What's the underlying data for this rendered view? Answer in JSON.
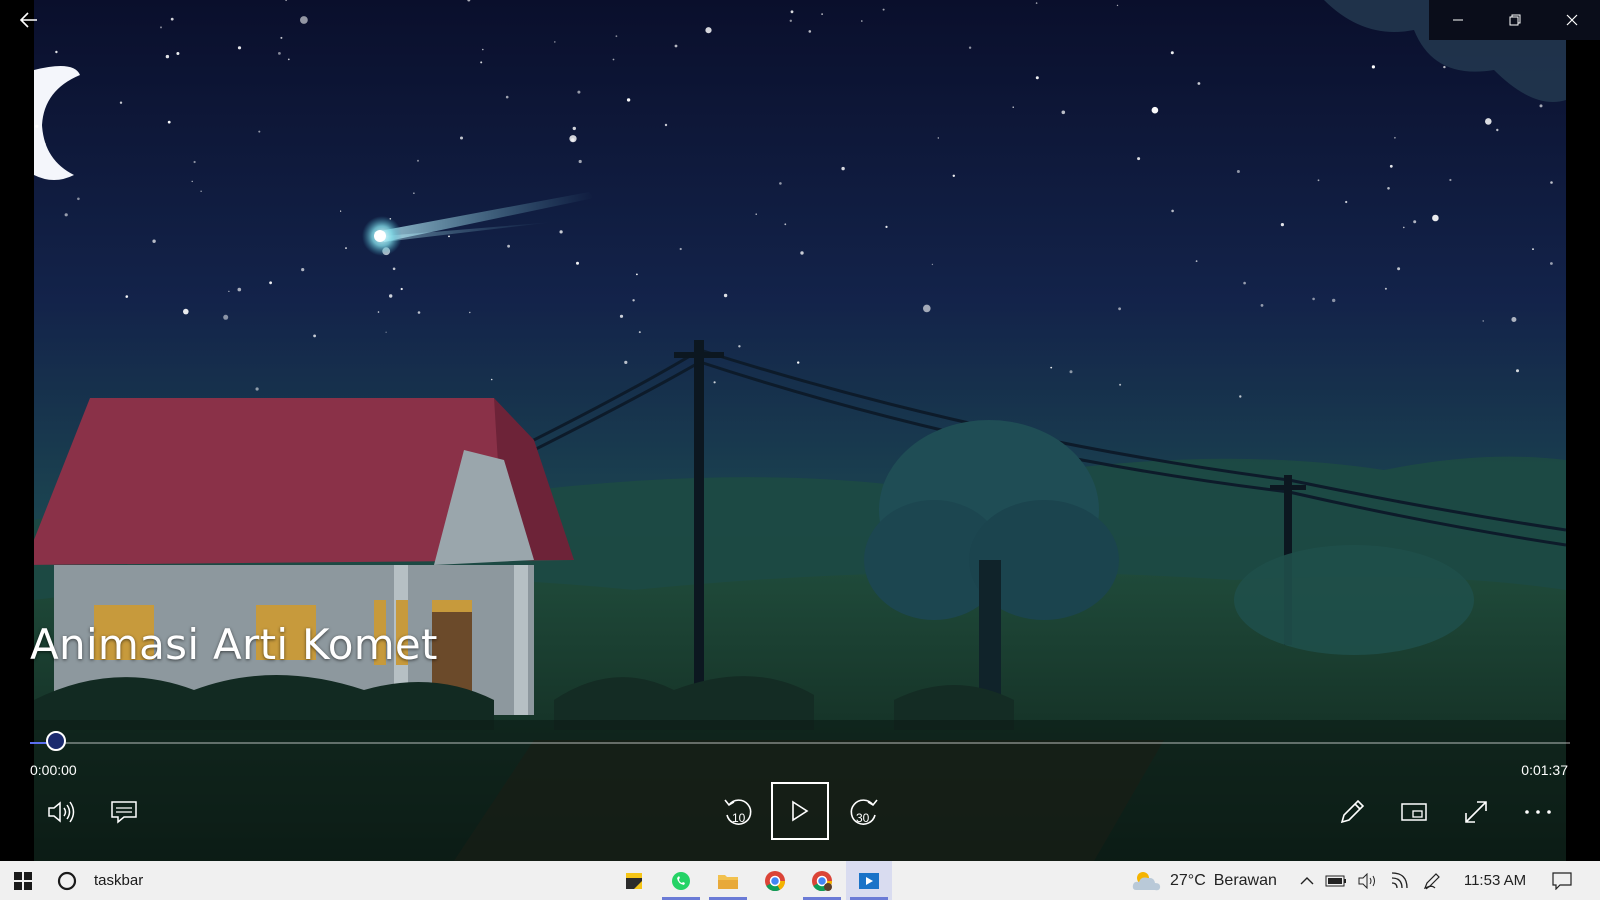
{
  "video": {
    "title": "Animasi Arti Komet",
    "current_time": "0:00:00",
    "duration": "0:01:37",
    "progress": 0.0
  },
  "controls": {
    "back_icon": "arrow-left-icon",
    "volume_icon": "speaker-icon",
    "subtitles_icon": "captions-icon",
    "skip_back_label": "10",
    "play_icon": "play-icon",
    "skip_forward_label": "30",
    "edit_icon": "pencil-icon",
    "miniplayer_icon": "mini-view-icon",
    "fullscreen_icon": "expand-icon",
    "more_icon": "more-icon"
  },
  "window": {
    "minimize_icon": "minimize-icon",
    "restore_icon": "restore-icon",
    "close_icon": "close-icon"
  },
  "taskbar": {
    "search_label": "taskbar",
    "apps": [
      "sticky-notes",
      "whatsapp",
      "file-explorer",
      "chrome",
      "chrome-profile",
      "movies-tv"
    ],
    "weather_temp": "27°C",
    "weather_desc": "Berawan",
    "clock": "11:53 AM"
  },
  "colors": {
    "accent": "#5b6ff0",
    "taskbar_bg": "#f0f0f0",
    "sky_top": "#0b1030",
    "sky_bottom": "#1a4a52"
  }
}
